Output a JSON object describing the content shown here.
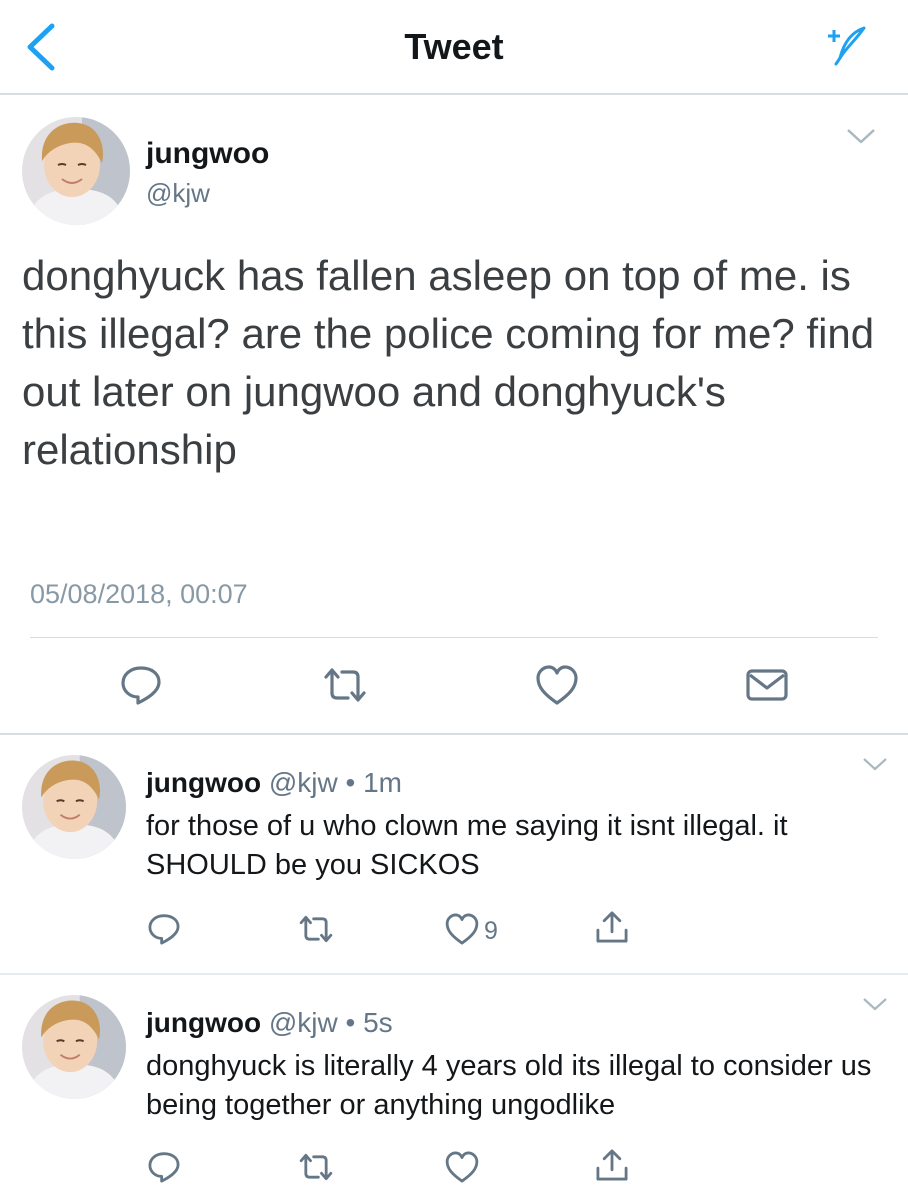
{
  "nav": {
    "title": "Tweet",
    "back_icon": "chevron-left-icon",
    "compose_icon": "compose-tweet-icon",
    "accent": "#1da1f2"
  },
  "tweet": {
    "name": "jungwoo",
    "handle": "@kjw",
    "text": "donghyuck has fallen asleep on top of me. is this illegal? are the police coming for me? find out later on jungwoo and donghyuck's relationship",
    "timestamp": "05/08/2018, 00:07"
  },
  "replies": [
    {
      "name": "jungwoo",
      "meta": "@kjw • 1m",
      "text": "for those of u who clown me saying it isnt illegal. it SHOULD be you SICKOS",
      "like_count": "9"
    },
    {
      "name": "jungwoo",
      "meta": "@kjw • 5s",
      "text": "donghyuck is literally 4 years old its illegal to consider us being together or anything ungodlike",
      "like_count": ""
    }
  ],
  "colors": {
    "text": "#14171a",
    "secondary": "#657786",
    "icon": "#657786",
    "divider": "#e6ecf0"
  }
}
